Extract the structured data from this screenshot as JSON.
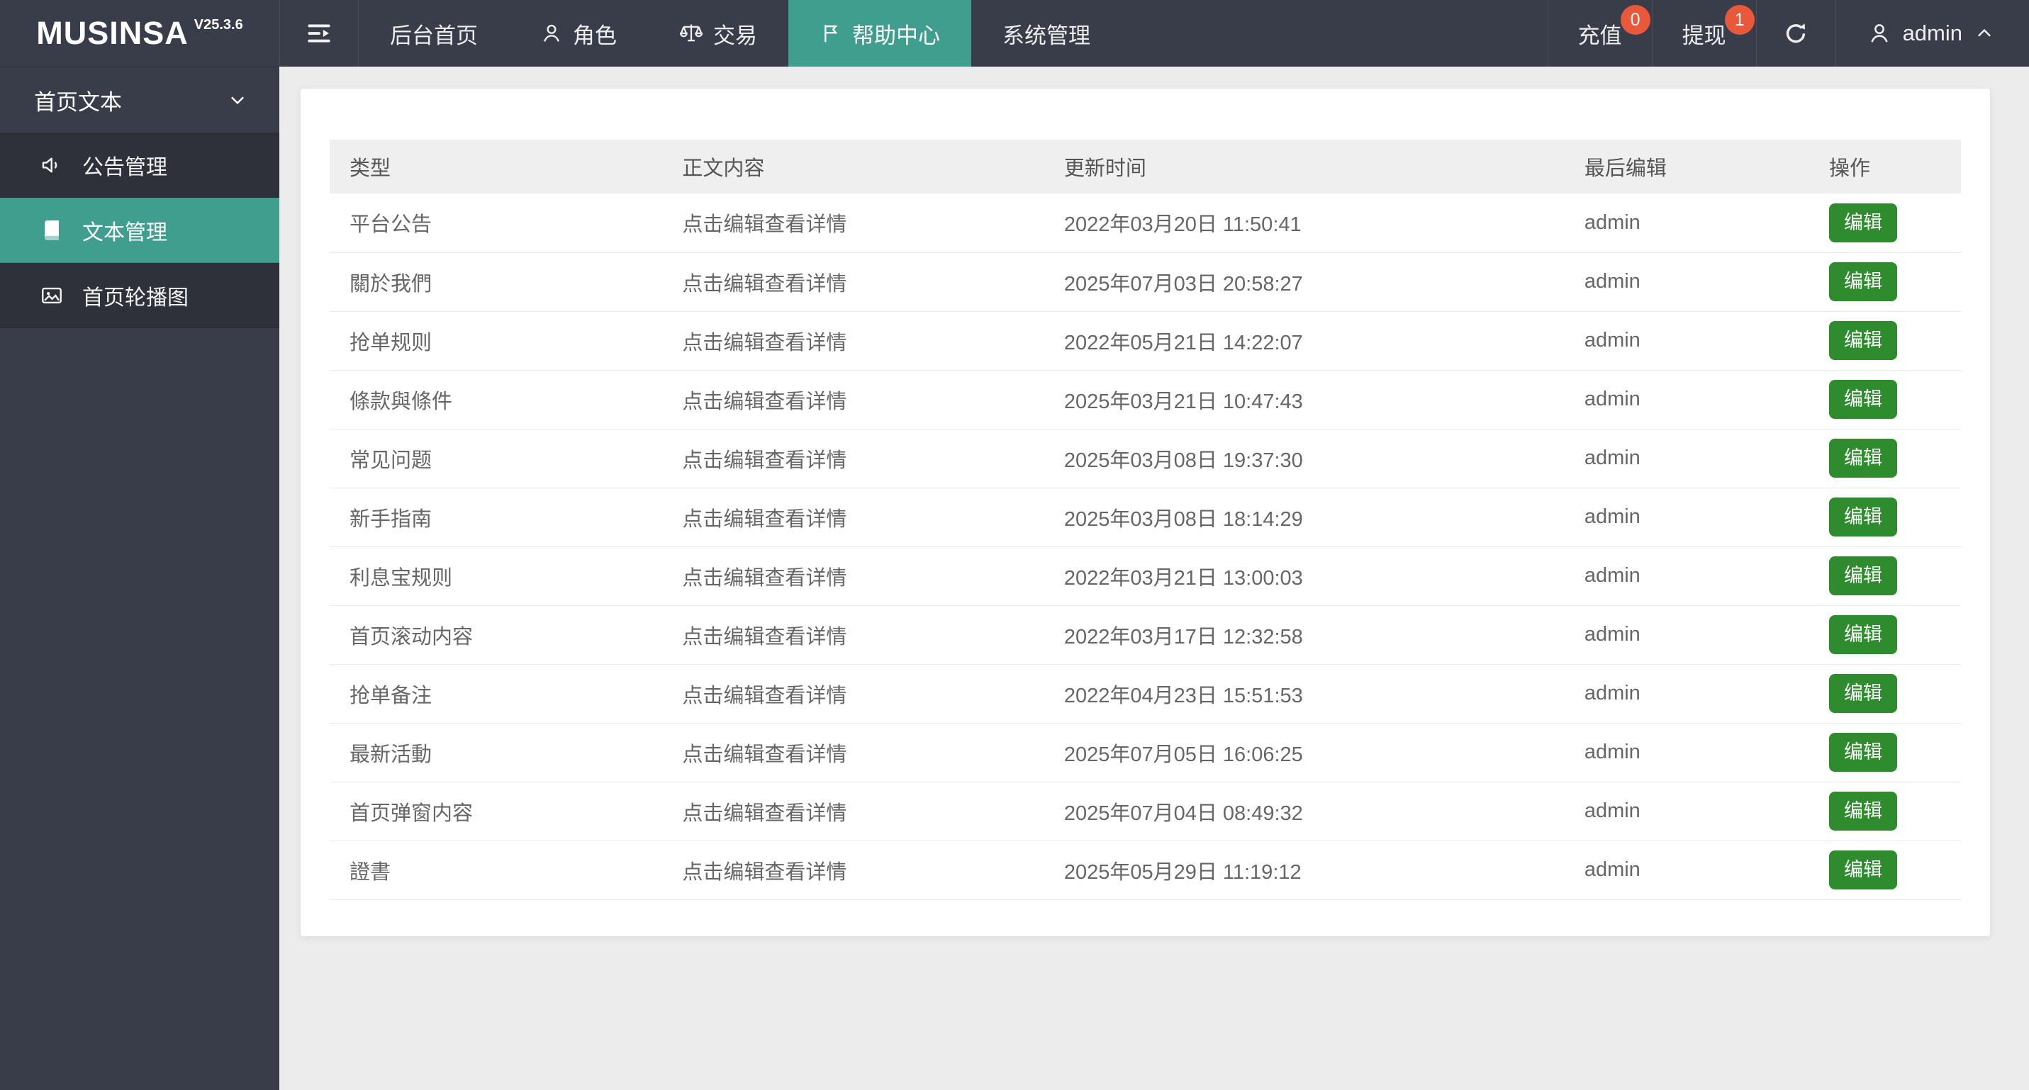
{
  "app": {
    "brand": "MUSINSA",
    "version": "V25.3.6"
  },
  "colors": {
    "topbar_dark": "#393D49",
    "accent_teal": "#3F9E8E",
    "badge_orange": "#E8593B",
    "edit_green": "#2E8B2E"
  },
  "topbar": {
    "nav": [
      {
        "name": "dashboard",
        "label": "后台首页",
        "icon": null,
        "active": false
      },
      {
        "name": "roles",
        "label": "角色",
        "icon": "user",
        "active": false
      },
      {
        "name": "trade",
        "label": "交易",
        "icon": "scales",
        "active": false
      },
      {
        "name": "help-center",
        "label": "帮助中心",
        "icon": "flag",
        "active": true
      },
      {
        "name": "system",
        "label": "系统管理",
        "icon": null,
        "active": false
      }
    ],
    "actions": [
      {
        "name": "recharge",
        "label": "充值",
        "badge": "0"
      },
      {
        "name": "withdraw",
        "label": "提现",
        "badge": "1"
      }
    ],
    "user": {
      "name": "admin"
    }
  },
  "sidebar": {
    "section": {
      "label": "首页文本"
    },
    "items": [
      {
        "name": "announcement-management",
        "label": "公告管理",
        "icon": "speaker",
        "active": false
      },
      {
        "name": "text-management",
        "label": "文本管理",
        "icon": "book",
        "active": true
      },
      {
        "name": "home-carousel",
        "label": "首页轮播图",
        "icon": "image",
        "active": false
      }
    ]
  },
  "table": {
    "columns": [
      "类型",
      "正文内容",
      "更新时间",
      "最后编辑",
      "操作"
    ],
    "edit_label": "编辑",
    "rows": [
      {
        "type": "平台公告",
        "content": "点击编辑查看详情",
        "updated": "2022年03月20日 11:50:41",
        "editor": "admin"
      },
      {
        "type": "關於我們",
        "content": "点击编辑查看详情",
        "updated": "2025年07月03日 20:58:27",
        "editor": "admin"
      },
      {
        "type": "抢单规则",
        "content": "点击编辑查看详情",
        "updated": "2022年05月21日 14:22:07",
        "editor": "admin"
      },
      {
        "type": "條款與條件",
        "content": "点击编辑查看详情",
        "updated": "2025年03月21日 10:47:43",
        "editor": "admin"
      },
      {
        "type": "常见问题",
        "content": "点击编辑查看详情",
        "updated": "2025年03月08日 19:37:30",
        "editor": "admin"
      },
      {
        "type": "新手指南",
        "content": "点击编辑查看详情",
        "updated": "2025年03月08日 18:14:29",
        "editor": "admin"
      },
      {
        "type": "利息宝规则",
        "content": "点击编辑查看详情",
        "updated": "2022年03月21日 13:00:03",
        "editor": "admin"
      },
      {
        "type": "首页滚动内容",
        "content": "点击编辑查看详情",
        "updated": "2022年03月17日 12:32:58",
        "editor": "admin"
      },
      {
        "type": "抢单备注",
        "content": "点击编辑查看详情",
        "updated": "2022年04月23日 15:51:53",
        "editor": "admin"
      },
      {
        "type": "最新活動",
        "content": "点击编辑查看详情",
        "updated": "2025年07月05日 16:06:25",
        "editor": "admin"
      },
      {
        "type": "首页弹窗内容",
        "content": "点击编辑查看详情",
        "updated": "2025年07月04日 08:49:32",
        "editor": "admin"
      },
      {
        "type": "證書",
        "content": "点击编辑查看详情",
        "updated": "2025年05月29日 11:19:12",
        "editor": "admin"
      }
    ]
  }
}
